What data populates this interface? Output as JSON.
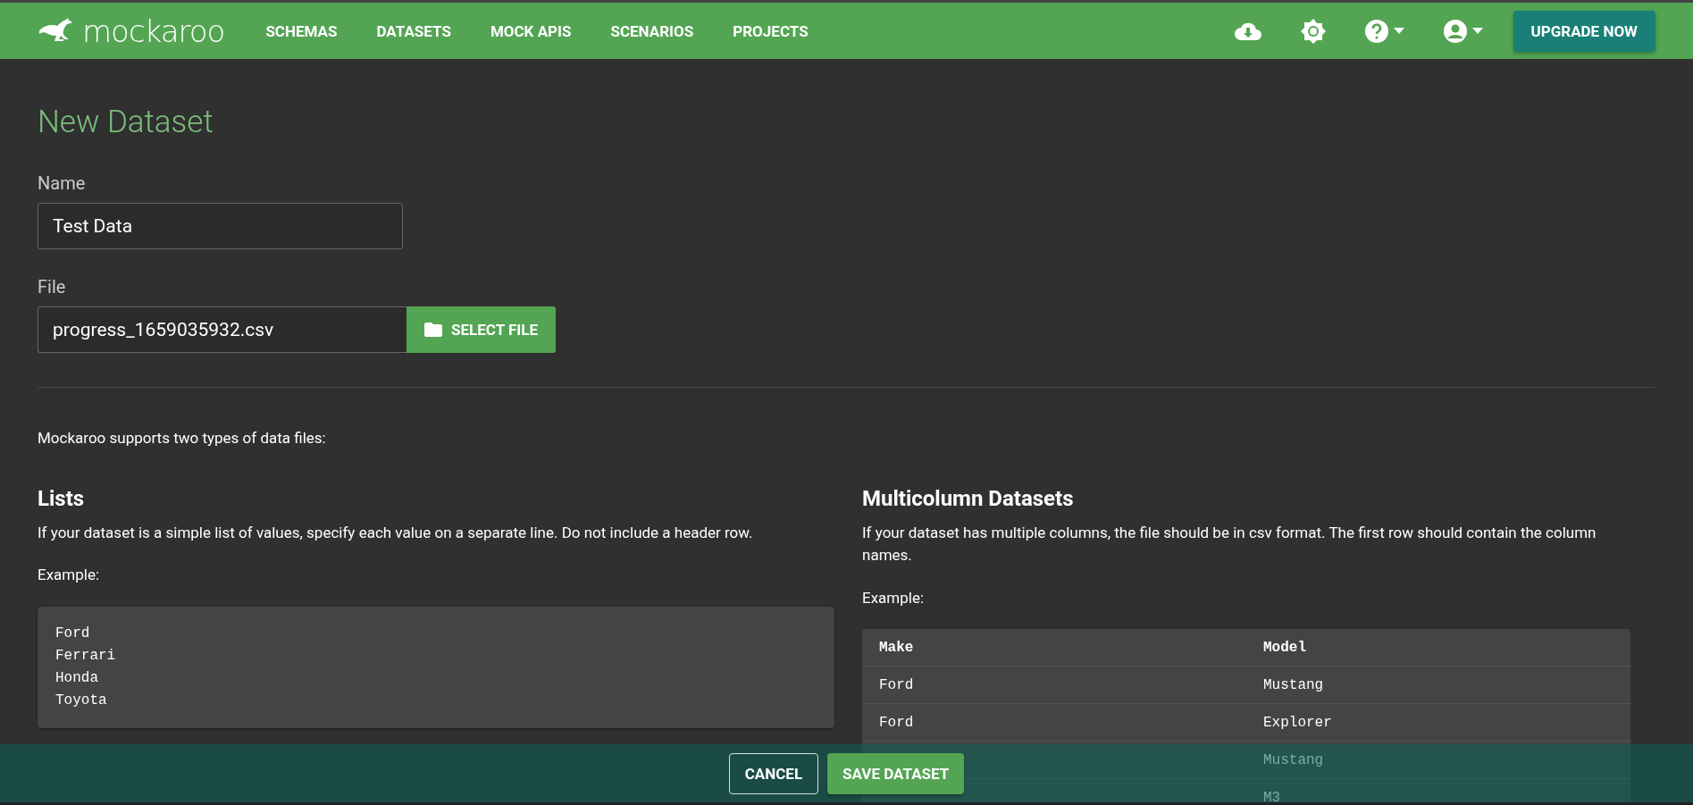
{
  "nav": {
    "logo": "mockaroo",
    "links": [
      "SCHEMAS",
      "DATASETS",
      "MOCK APIS",
      "SCENARIOS",
      "PROJECTS"
    ],
    "upgrade": "UPGRADE NOW"
  },
  "page": {
    "title": "New Dataset",
    "name_field": {
      "label": "Name",
      "value": "Test Data"
    },
    "file_field": {
      "label": "File",
      "value": "progress_1659035932.csv",
      "button": "SELECT FILE"
    },
    "intro": "Mockaroo supports two types of data files:",
    "lists": {
      "heading": "Lists",
      "description": "If your dataset is a simple list of values, specify each value on a separate line. Do not include a header row.",
      "example_label": "Example:",
      "example_lines": [
        "Ford",
        "Ferrari",
        "Honda",
        "Toyota"
      ]
    },
    "multicolumn": {
      "heading": "Multicolumn Datasets",
      "description": "If your dataset has multiple columns, the file should be in csv format. The first row should contain the column names.",
      "example_label": "Example:",
      "table": {
        "columns": [
          "Make",
          "Model"
        ],
        "rows": [
          {
            "make": "Ford",
            "model": "Mustang"
          },
          {
            "make": "Ford",
            "model": "Explorer"
          },
          {
            "model": "Mustang"
          },
          {
            "model": "M3"
          }
        ]
      }
    }
  },
  "footer": {
    "buttons": [
      {
        "label": "CANCEL",
        "kind": "outline"
      },
      {
        "label": "SAVE DATASET",
        "kind": "primary"
      }
    ]
  }
}
